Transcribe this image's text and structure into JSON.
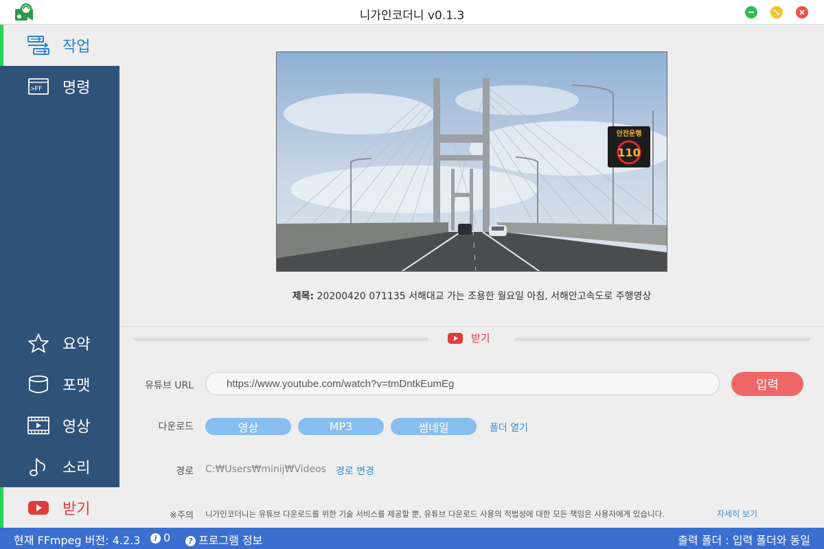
{
  "window": {
    "title": "니가인코더니 v0.1.3"
  },
  "sidebar": {
    "items": [
      {
        "label": "작업",
        "icon": "work-icon"
      },
      {
        "label": "명령",
        "icon": "command-icon"
      },
      {
        "label": "요약",
        "icon": "star-icon"
      },
      {
        "label": "포맷",
        "icon": "format-icon"
      },
      {
        "label": "영상",
        "icon": "film-icon"
      },
      {
        "label": "소리",
        "icon": "music-note-icon"
      },
      {
        "label": "받기",
        "icon": "youtube-icon"
      }
    ],
    "active": "받기"
  },
  "preview": {
    "title_label": "제목:",
    "title_value": "20200420 071135 서해대교 가는 조용한 월요일 아침, 서해안고속도로 주행영상",
    "sign_text": "안전운행",
    "sign_speed": "110"
  },
  "receive": {
    "section_title": "받기",
    "url_label": "유튜브 URL",
    "url_value": "https://www.youtube.com/watch?v=tmDntkEumEg",
    "submit_label": "입력",
    "download_label": "다운로드",
    "download_buttons": [
      "영상",
      "MP3",
      "썸네일"
    ],
    "open_folder_label": "폴더 열기",
    "path_label": "경로",
    "path_value": "C:₩Users₩minij₩Videos",
    "change_path_label": "경로 변경",
    "notice_label": "※주의",
    "notice_text": "니가인코더니는 유튜브 다운로드를 위한 기술 서비스를 제공할 뿐, 유튜브 다운로드 사용의 적법성에 대한 모든 책임은 사용자에게 있습니다.",
    "details_label": "자세히 보기"
  },
  "statusbar": {
    "ffmpeg_version": "현재 FFmpeg 버전: 4.2.3",
    "info_count": "0",
    "program_info": "프로그램 정보",
    "output_folder": "출력 폴더 : 입력 폴더와 동일"
  },
  "colors": {
    "sidebar_bg": "#2f5279",
    "accent_green": "#28d25a",
    "active_blue": "#2b7fd8",
    "youtube_red": "#e23b3b",
    "submit_red": "#f06666",
    "pill_blue": "#88bdf0",
    "status_blue": "#3a6fd0"
  }
}
